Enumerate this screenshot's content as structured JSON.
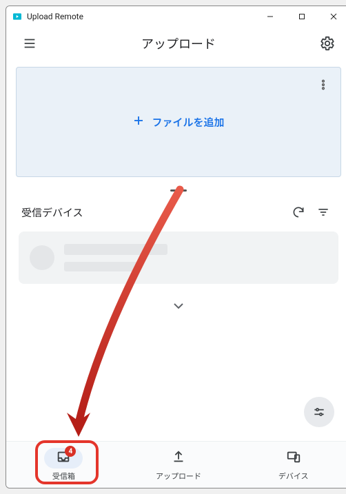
{
  "window": {
    "title": "Upload Remote"
  },
  "header": {
    "title": "アップロード"
  },
  "upload": {
    "addFileLabel": "ファイルを追加"
  },
  "devices": {
    "title": "受信デバイス"
  },
  "nav": {
    "inbox": {
      "label": "受信箱",
      "badge": "4"
    },
    "upload": {
      "label": "アップロード"
    },
    "devices": {
      "label": "デバイス"
    }
  },
  "annotation": {
    "highlightColor": "#e4352b"
  }
}
